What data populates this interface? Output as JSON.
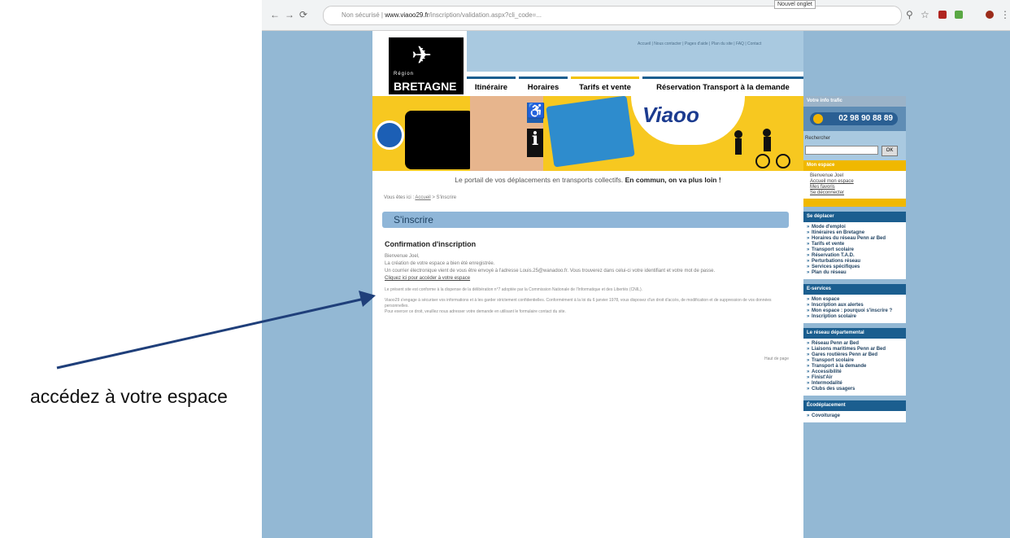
{
  "browser": {
    "url_security": "Non sécurisé",
    "url_domain": "www.viaoo29.fr",
    "url_path": "/inscription/validation.aspx?cli_code=...",
    "tooltip": "Nouvel onglet"
  },
  "site": {
    "top_links": "Accueil | Nous contacter | Pages d'aide | Plan du site | FAQ | Contact",
    "logo_region": "Région",
    "logo_name": "BRETAGNE",
    "tabs": [
      "Itinéraire",
      "Horaires",
      "Tarifs et vente",
      "Réservation Transport à la demande"
    ],
    "banner_brand": "Viaoo",
    "tagline_normal": "Le portail de vos déplacements en transports collectifs.",
    "tagline_bold": "En commun, on va plus loin !",
    "breadcrumb_prefix": "Vous êtes ici :",
    "breadcrumb_home": "Accueil",
    "breadcrumb_current": "> S'inscrire",
    "page_title": "S'inscrire"
  },
  "content": {
    "heading": "Confirmation d'inscription",
    "greeting": "Bienvenue Joel,",
    "line1": "La création de votre espace a bien été enregistrée.",
    "line2": "Un courrier électronique vient de vous être envoyé à l'adresse Louis.25@wanadoo.fr. Vous trouverez dans celui-ci votre identifiant et votre mot de passe.",
    "access_link": "Cliquez ici pour accéder à votre espace",
    "legal1": "Le présent site est conforme à la dispense de la délibération n°7 adoptée par la Commission Nationale de l'Informatique et des Libertés (CNIL).",
    "legal2": "Viaoo29 s'engage à sécuriser vos informations et à les garder strictement confidentielles. Conformément à la loi du 6 janvier 1978, vous disposez d'un droit d'accès, de modification et de suppression de vos données personnelles.",
    "legal3": "Pour exercer ce droit, veuillez nous adresser votre demande en utilisant le formulaire contact du site.",
    "top_link": "Haut de page"
  },
  "sidebar": {
    "info_title": "Votre info trafic",
    "phone": "02 98 90 88 89",
    "search_label": "Rechercher",
    "search_button": "OK",
    "espace_title": "Mon espace",
    "espace_greeting": "Bienvenue Joel",
    "espace_links": [
      "Accueil mon espace",
      "Mes favoris",
      "Se déconnecter"
    ],
    "deplacer_title": "Se déplacer",
    "deplacer_items": [
      "Mode d'emploi",
      "Itinéraires en Bretagne",
      "Horaires du réseau Penn ar Bed",
      "Tarifs et vente",
      "Transport scolaire",
      "Réservation T.A.D.",
      "Perturbations réseau",
      "Services spécifiques",
      "Plan du réseau"
    ],
    "eservices_title": "E-services",
    "eservices_items": [
      "Mon espace",
      "Inscription aux alertes",
      "Mon espace : pourquoi s'inscrire ?",
      "Inscription scolaire"
    ],
    "reseau_title": "Le réseau départemental",
    "reseau_items": [
      "Réseau Penn ar Bed",
      "Liaisons maritimes Penn ar Bed",
      "Gares routières Penn ar Bed",
      "Transport scolaire",
      "Transport à la demande",
      "Accessibilité",
      "Finist'Air",
      "Intermodalité",
      "Clubs des usagers"
    ],
    "ecomobilite_title": "Écodéplacement",
    "ecomobilite_items": [
      "Covoiturage"
    ]
  },
  "annotation": {
    "caption": "accédez à votre espace"
  },
  "colors": {
    "page_background": "#93b8d4",
    "accent_blue": "#1b5e8f",
    "accent_yellow": "#f0b800",
    "arrow": "#1f3f7a"
  }
}
